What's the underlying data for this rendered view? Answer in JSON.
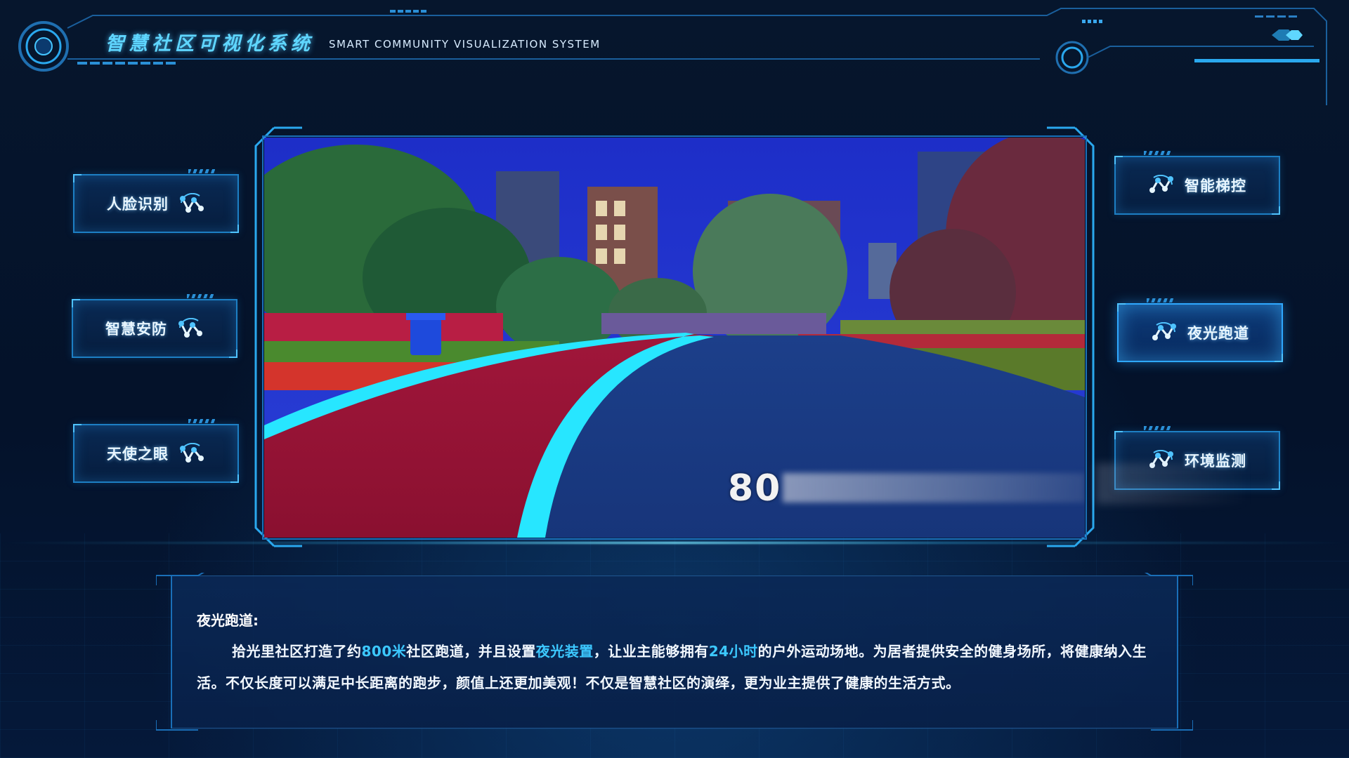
{
  "header": {
    "title": "智慧社区可视化系统",
    "subtitle": "SMART COMMUNITY VISUALIZATION SYSTEM"
  },
  "left_menu": [
    {
      "label": "人脸识别",
      "icon": "network-nodes-icon"
    },
    {
      "label": "智慧安防",
      "icon": "network-nodes-icon"
    },
    {
      "label": "天使之眼",
      "icon": "network-nodes-icon"
    }
  ],
  "right_menu": [
    {
      "label": "智能梯控",
      "icon": "network-nodes-icon",
      "active": false
    },
    {
      "label": "夜光跑道",
      "icon": "network-nodes-icon",
      "active": true
    },
    {
      "label": "环境监测",
      "icon": "network-nodes-icon",
      "active": false
    }
  ],
  "scene": {
    "overlay_text": "80"
  },
  "description": {
    "title": "夜光跑道:",
    "segments": [
      {
        "text": "拾光里社区打造了约",
        "highlight": false
      },
      {
        "text": "800米",
        "highlight": true
      },
      {
        "text": "社区跑道，并且设置",
        "highlight": false
      },
      {
        "text": "夜光装置",
        "highlight": true
      },
      {
        "text": "，让业主能够拥有",
        "highlight": false
      },
      {
        "text": "24小时",
        "highlight": true
      },
      {
        "text": "的户外运动场地。为居者提供安全的健身场所，将健康纳入生活。不仅长度可以满足中长距离的跑步，颜值上还更加美观！不仅是智慧社区的演绎，更为业主提供了健康的生活方式。",
        "highlight": false
      }
    ]
  },
  "colors": {
    "accent": "#3cc8ff",
    "border": "#1d7fc4",
    "background": "#041024"
  }
}
